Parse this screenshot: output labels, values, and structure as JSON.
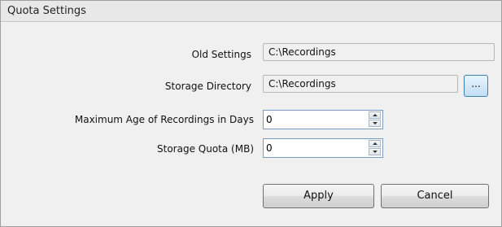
{
  "header": {
    "title": "Quota Settings"
  },
  "form": {
    "old_settings": {
      "label": "Old Settings",
      "value": "C:\\Recordings"
    },
    "storage_directory": {
      "label": "Storage Directory",
      "value": "C:\\Recordings",
      "browse_label": "..."
    },
    "max_age": {
      "label": "Maximum Age of Recordings in Days",
      "value": "0"
    },
    "storage_quota": {
      "label": "Storage Quota (MB)",
      "value": "0"
    }
  },
  "buttons": {
    "apply": "Apply",
    "cancel": "Cancel"
  }
}
